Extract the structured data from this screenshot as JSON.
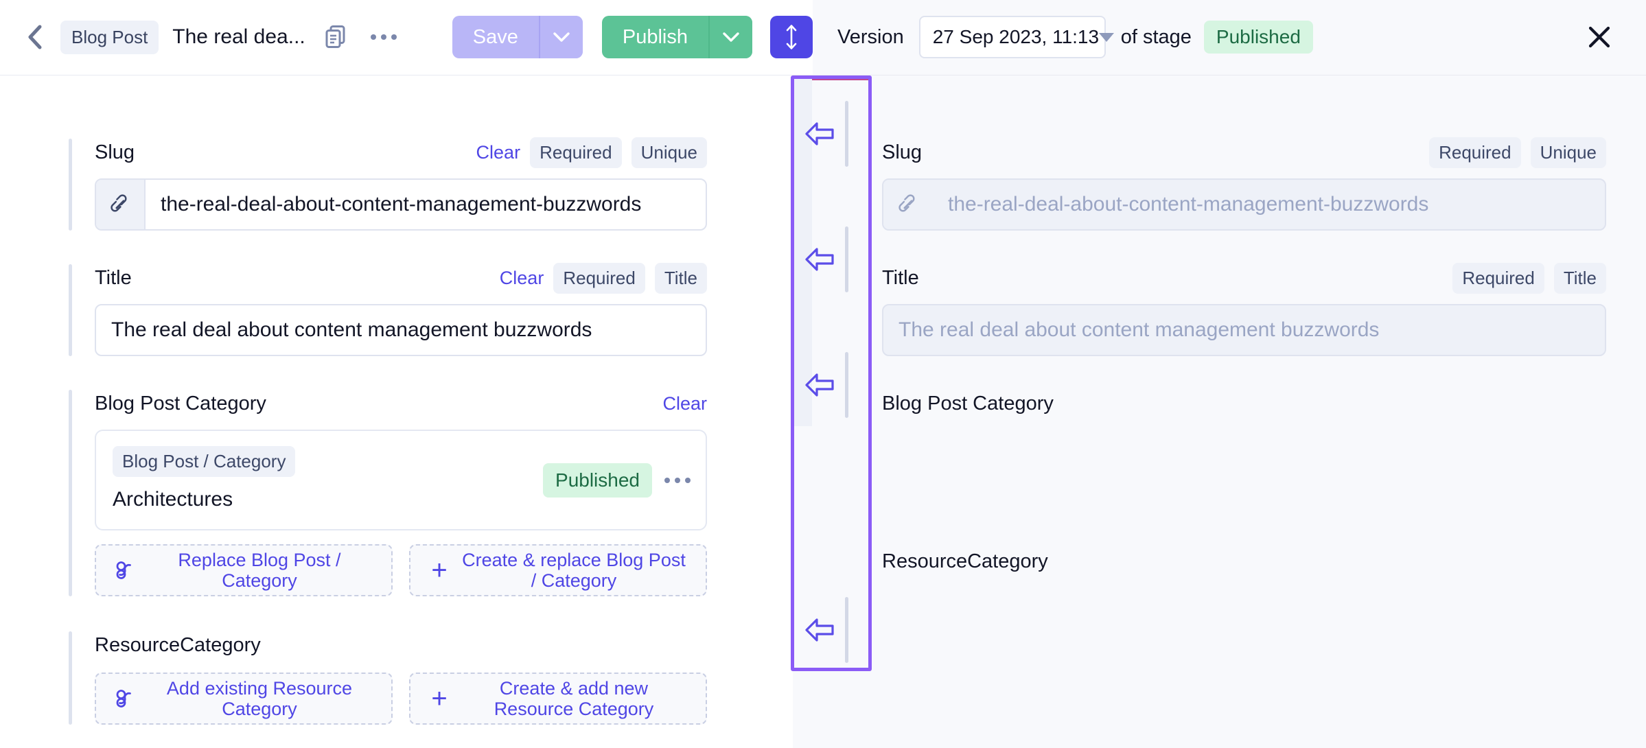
{
  "header": {
    "back_icon": "chevron-left-icon",
    "type_chip": "Blog Post",
    "doc_title": "The real dea...",
    "duplicate_icon": "copy-icon",
    "more_icon": "ellipsis-icon",
    "save_label": "Save",
    "save_caret_icon": "chevron-down-icon",
    "publish_label": "Publish",
    "publish_caret_icon": "chevron-down-icon",
    "updown_icon": "arrows-up-down-icon",
    "version_label": "Version",
    "version_value": "27 Sep 2023, 11:13",
    "version_caret_icon": "triangle-down-icon",
    "of_stage_label": "of stage",
    "stage_value": "Published",
    "close_icon": "close-icon",
    "colors": {
      "save_bg": "#b9b6f7",
      "publish_bg": "#5cc396",
      "updown_bg": "#4f46e5",
      "stage_chip_bg": "#d6f5e1",
      "stage_chip_fg": "#1d6b44",
      "accent": "#4f46e5",
      "right_panel_bg": "#f8f9fc"
    }
  },
  "left_pane": {
    "slug": {
      "label": "Slug",
      "clear_label": "Clear",
      "tags": [
        "Required",
        "Unique"
      ],
      "icon": "link-icon",
      "value": "the-real-deal-about-content-management-buzzwords"
    },
    "title": {
      "label": "Title",
      "clear_label": "Clear",
      "tags": [
        "Required",
        "Title"
      ],
      "value": "The real deal about content management buzzwords"
    },
    "blog_post_category": {
      "label": "Blog Post Category",
      "clear_label": "Clear",
      "card": {
        "type_chip": "Blog Post / Category",
        "name": "Architectures",
        "status": "Published",
        "more_icon": "ellipsis-icon"
      },
      "actions": [
        {
          "icon": "link-icon",
          "label": "Replace Blog Post / Category"
        },
        {
          "icon": "plus-icon",
          "label": "Create & replace Blog Post / Category"
        }
      ]
    },
    "resource_category": {
      "label": "ResourceCategory",
      "actions": [
        {
          "icon": "link-icon",
          "label": "Add existing Resource Category"
        },
        {
          "icon": "plus-icon",
          "label": "Create & add new Resource Category"
        }
      ]
    }
  },
  "gutter": {
    "highlight_color": "#8b5cf6",
    "arrows": [
      {
        "icon": "arrow-left-icon",
        "name": "copy-slug-to-left"
      },
      {
        "icon": "arrow-left-icon",
        "name": "copy-title-to-left"
      },
      {
        "icon": "arrow-left-icon",
        "name": "copy-blog-post-category-to-left"
      },
      {
        "icon": "arrow-left-icon",
        "name": "copy-resource-category-to-left"
      }
    ]
  },
  "right_pane": {
    "slug": {
      "label": "Slug",
      "tags": [
        "Required",
        "Unique"
      ],
      "icon": "link-icon",
      "value": "the-real-deal-about-content-management-buzzwords"
    },
    "title": {
      "label": "Title",
      "tags": [
        "Required",
        "Title"
      ],
      "value": "The real deal about content management buzzwords"
    },
    "blog_post_category": {
      "label": "Blog Post Category"
    },
    "resource_category": {
      "label": "ResourceCategory"
    }
  }
}
